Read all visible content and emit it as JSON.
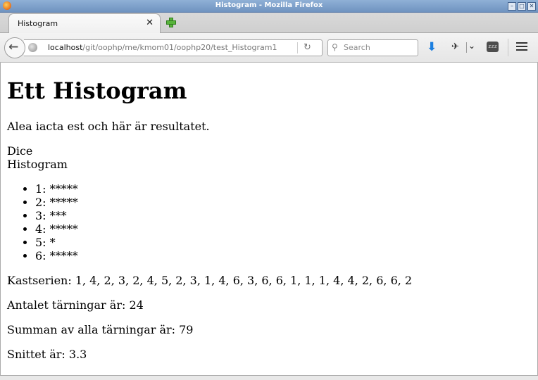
{
  "window": {
    "title": "Histogram - Mozilla Firefox",
    "app_icon": "firefox-icon",
    "controls": [
      "minimize-icon",
      "maximize-icon",
      "close-icon"
    ]
  },
  "tab": {
    "title": "Histogram",
    "close_icon": "close-icon",
    "new_tab_icon": "plus-icon"
  },
  "navbar": {
    "url_host": "localhost",
    "url_path": "/git/oophp/me/kmom01/oophp20/test_Histogram1",
    "search_placeholder": "Search",
    "sleep_icon_text": "zzz",
    "icons": [
      "back-arrow-icon",
      "globe-icon",
      "reload-icon",
      "search-icon",
      "download-icon",
      "addon-icon",
      "chevron-down-icon",
      "sleep-icon",
      "menu-icon"
    ],
    "download_color": "#1c7fe0"
  },
  "page": {
    "heading": "Ett Histogram",
    "intro": "Alea iacta est och här är resultatet.",
    "dice_label": "Dice",
    "histogram_label": "Histogram",
    "histogram": [
      "1: *****",
      "2: *****",
      "3: ***",
      "4: *****",
      "5: *",
      "6: *****"
    ],
    "kastserien": "Kastserien: 1, 4, 2, 3, 2, 4, 5, 2, 3, 1, 4, 6, 3, 6, 6, 1, 1, 1, 4, 4, 2, 6, 6, 2",
    "antal": "Antalet tärningar är: 24",
    "summa": "Summan av alla tärningar är: 79",
    "snitt": "Snittet är: 3.3"
  }
}
